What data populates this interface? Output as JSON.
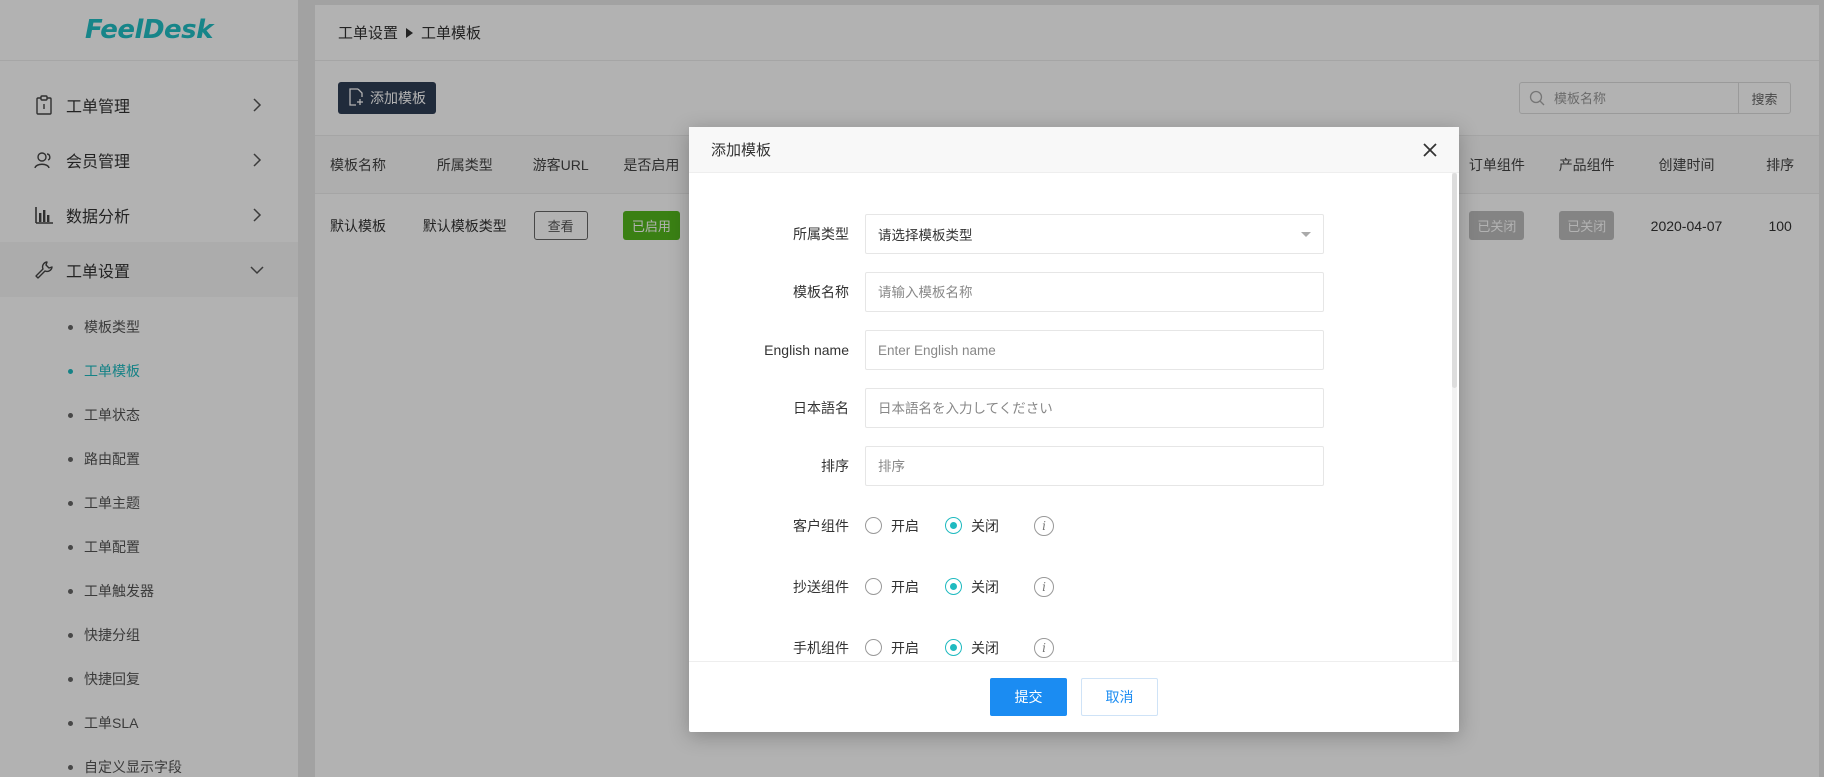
{
  "app": {
    "logo": "FeelDesk"
  },
  "sidebar": {
    "items": [
      {
        "label": "工单管理",
        "icon": "clipboard-icon"
      },
      {
        "label": "会员管理",
        "icon": "users-icon"
      },
      {
        "label": "数据分析",
        "icon": "bar-chart-icon"
      },
      {
        "label": "工单设置",
        "icon": "wrench-icon"
      }
    ],
    "submenu": [
      "模板类型",
      "工单模板",
      "工单状态",
      "路由配置",
      "工单主题",
      "工单配置",
      "工单触发器",
      "快捷分组",
      "快捷回复",
      "工单SLA",
      "自定义显示字段"
    ],
    "active_sub": "工单模板"
  },
  "breadcrumb": {
    "parent": "工单设置",
    "current": "工单模板"
  },
  "toolbar": {
    "add_label": "添加模板",
    "search_placeholder": "模板名称",
    "search_button": "搜索"
  },
  "table": {
    "headers_left": [
      "模板名称",
      "所属类型",
      "游客URL",
      "是否启用"
    ],
    "headers_right": [
      "订单组件",
      "产品组件",
      "创建时间",
      "排序"
    ],
    "rows": [
      {
        "name": "默认模板",
        "type": "默认模板类型",
        "url_button": "查看",
        "enabled": "已启用",
        "order_component": "已关闭",
        "product_component": "已关闭",
        "created": "2020-04-07",
        "sort": "100"
      }
    ]
  },
  "modal": {
    "title": "添加模板",
    "fields": {
      "type": {
        "label": "所属类型",
        "value": "请选择模板类型"
      },
      "name": {
        "label": "模板名称",
        "placeholder": "请输入模板名称"
      },
      "english": {
        "label": "English name",
        "placeholder": "Enter English name"
      },
      "japanese": {
        "label": "日本語名",
        "placeholder": "日本語名を入力してください"
      },
      "sort": {
        "label": "排序",
        "placeholder": "排序"
      }
    },
    "radios": [
      {
        "label": "客户组件",
        "on": "开启",
        "off": "关闭",
        "value": "off"
      },
      {
        "label": "抄送组件",
        "on": "开启",
        "off": "关闭",
        "value": "off"
      },
      {
        "label": "手机组件",
        "on": "开启",
        "off": "关闭",
        "value": "off"
      }
    ],
    "submit": "提交",
    "cancel": "取消"
  },
  "colors": {
    "accent": "#1fbac0",
    "primary": "#1b8cf2",
    "dark_button": "#2f3e55",
    "enabled_tag": "#54b81d"
  }
}
